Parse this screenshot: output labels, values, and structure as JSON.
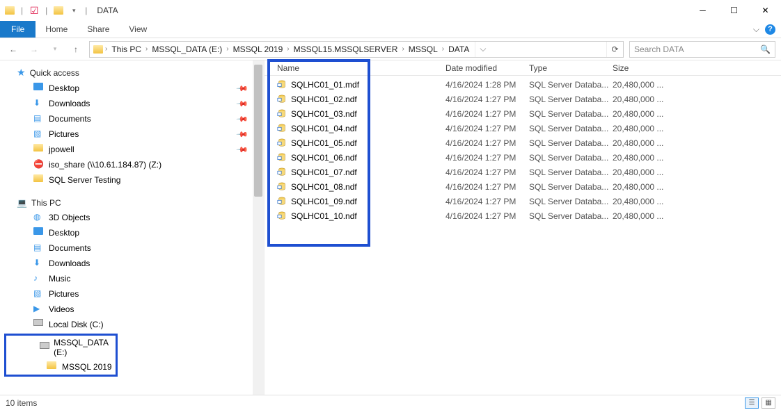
{
  "window": {
    "title": "DATA"
  },
  "ribbon": {
    "file": "File",
    "tabs": [
      "Home",
      "Share",
      "View"
    ]
  },
  "breadcrumb": [
    "This PC",
    "MSSQL_DATA (E:)",
    "MSSQL 2019",
    "MSSQL15.MSSQLSERVER",
    "MSSQL",
    "DATA"
  ],
  "search": {
    "placeholder": "Search DATA"
  },
  "columns": {
    "name": "Name",
    "date": "Date modified",
    "type": "Type",
    "size": "Size"
  },
  "nav": {
    "quick_access": "Quick access",
    "qa_items": [
      {
        "label": "Desktop",
        "pinned": true,
        "icon": "desktop"
      },
      {
        "label": "Downloads",
        "pinned": true,
        "icon": "download"
      },
      {
        "label": "Documents",
        "pinned": true,
        "icon": "doc"
      },
      {
        "label": "Pictures",
        "pinned": true,
        "icon": "pic"
      },
      {
        "label": "jpowell",
        "pinned": true,
        "icon": "folder"
      },
      {
        "label": "iso_share (\\\\10.61.184.87) (Z:)",
        "pinned": false,
        "icon": "netdrive"
      },
      {
        "label": "SQL Server Testing",
        "pinned": false,
        "icon": "folder"
      }
    ],
    "this_pc": "This PC",
    "pc_items": [
      {
        "label": "3D Objects",
        "icon": "3d"
      },
      {
        "label": "Desktop",
        "icon": "desktop"
      },
      {
        "label": "Documents",
        "icon": "doc"
      },
      {
        "label": "Downloads",
        "icon": "download"
      },
      {
        "label": "Music",
        "icon": "music"
      },
      {
        "label": "Pictures",
        "icon": "pic"
      },
      {
        "label": "Videos",
        "icon": "video"
      },
      {
        "label": "Local Disk (C:)",
        "icon": "disk"
      },
      {
        "label": "MSSQL_DATA (E:)",
        "icon": "disk"
      },
      {
        "label": "MSSQL 2019",
        "icon": "folder",
        "indent": true
      }
    ]
  },
  "files": [
    {
      "name": "SQLHC01_01.mdf",
      "date": "4/16/2024 1:28 PM",
      "type": "SQL Server Databa...",
      "size": "20,480,000 ..."
    },
    {
      "name": "SQLHC01_02.ndf",
      "date": "4/16/2024 1:27 PM",
      "type": "SQL Server Databa...",
      "size": "20,480,000 ..."
    },
    {
      "name": "SQLHC01_03.ndf",
      "date": "4/16/2024 1:27 PM",
      "type": "SQL Server Databa...",
      "size": "20,480,000 ..."
    },
    {
      "name": "SQLHC01_04.ndf",
      "date": "4/16/2024 1:27 PM",
      "type": "SQL Server Databa...",
      "size": "20,480,000 ..."
    },
    {
      "name": "SQLHC01_05.ndf",
      "date": "4/16/2024 1:27 PM",
      "type": "SQL Server Databa...",
      "size": "20,480,000 ..."
    },
    {
      "name": "SQLHC01_06.ndf",
      "date": "4/16/2024 1:27 PM",
      "type": "SQL Server Databa...",
      "size": "20,480,000 ..."
    },
    {
      "name": "SQLHC01_07.ndf",
      "date": "4/16/2024 1:27 PM",
      "type": "SQL Server Databa...",
      "size": "20,480,000 ..."
    },
    {
      "name": "SQLHC01_08.ndf",
      "date": "4/16/2024 1:27 PM",
      "type": "SQL Server Databa...",
      "size": "20,480,000 ..."
    },
    {
      "name": "SQLHC01_09.ndf",
      "date": "4/16/2024 1:27 PM",
      "type": "SQL Server Databa...",
      "size": "20,480,000 ..."
    },
    {
      "name": "SQLHC01_10.ndf",
      "date": "4/16/2024 1:27 PM",
      "type": "SQL Server Databa...",
      "size": "20,480,000 ..."
    }
  ],
  "status": {
    "count": "10 items"
  }
}
